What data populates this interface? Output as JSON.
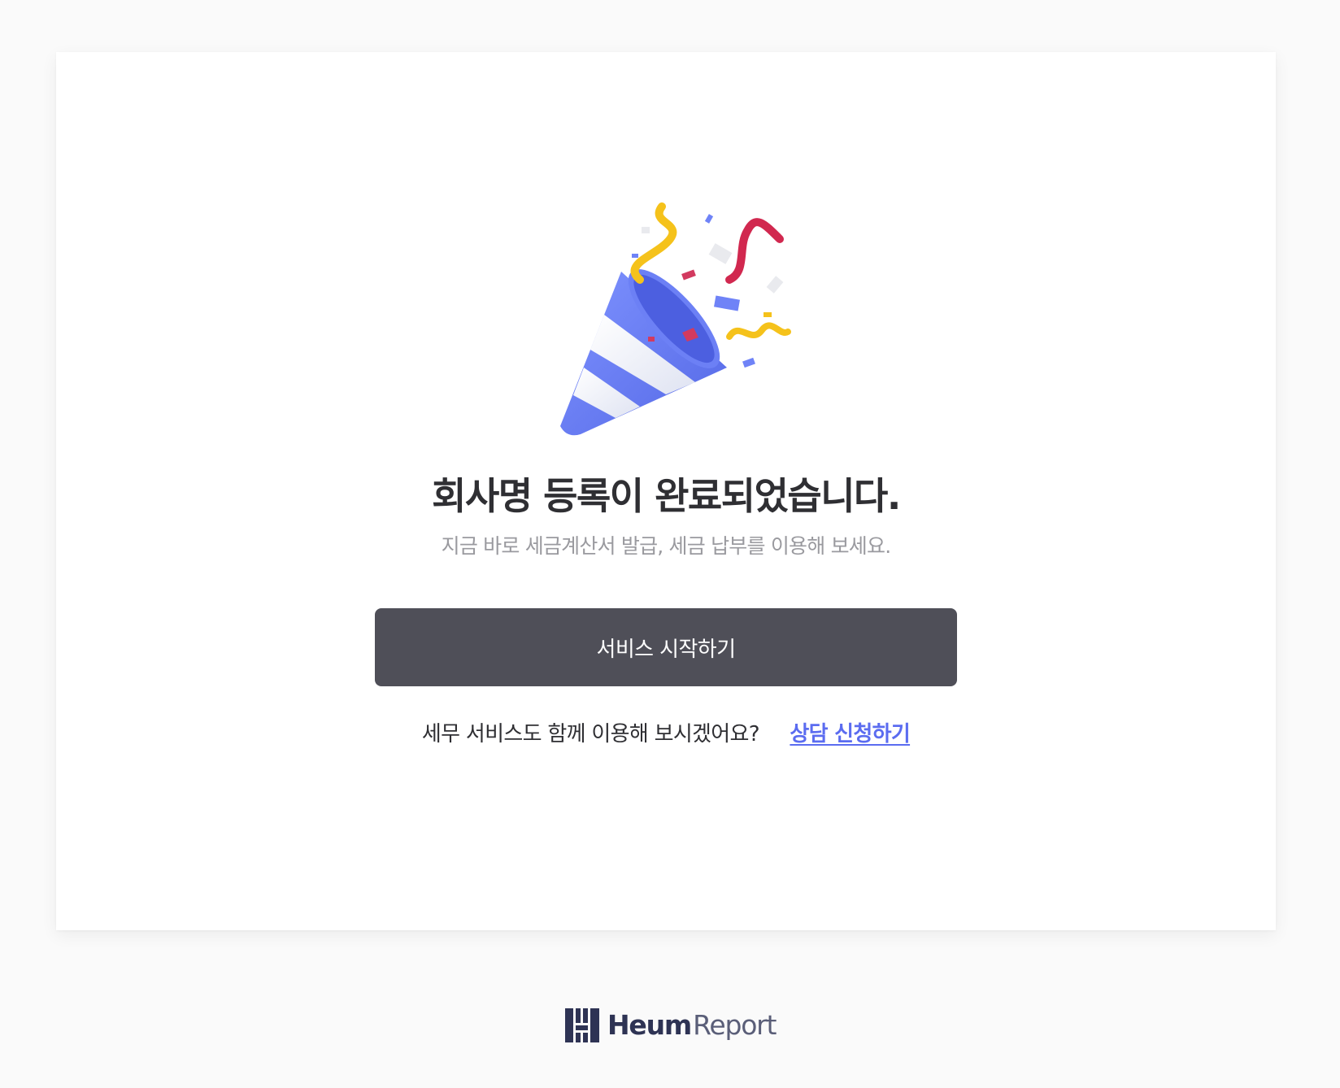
{
  "main": {
    "headline": "회사명 등록이 완료되었습니다.",
    "subtext": "지금 바로 세금계산서 발급, 세금 납부를 이용해 보세요.",
    "illustration": "party-popper-icon",
    "start_button_label": "서비스 시작하기",
    "tax_question": "세무 서비스도 함께 이용해 보시겠어요?",
    "consult_link_label": "상담 신청하기"
  },
  "footer": {
    "brand_strong": "Heum",
    "brand_light": "Report",
    "logo_icon": "heum-logo-icon"
  },
  "colors": {
    "page_background": "#fafafa",
    "card_background": "#ffffff",
    "button_background": "#4f4f58",
    "link": "#5b6cf0",
    "headline": "#2f2f33",
    "subtext": "#9a9a9f",
    "brand": "#2e3354"
  }
}
